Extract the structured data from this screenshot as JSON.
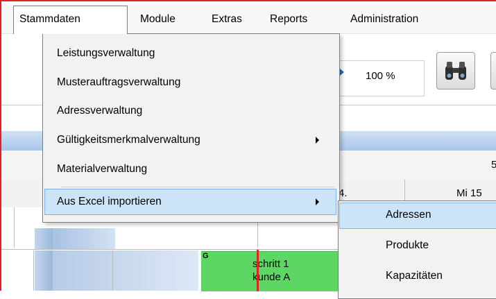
{
  "menubar": {
    "items": [
      "Stammdaten",
      "Module",
      "Extras",
      "Reports",
      "Administration"
    ],
    "active": "Stammdaten"
  },
  "toolbar": {
    "zoom_label": "100 %",
    "search_icon": "binoculars-icon"
  },
  "calendar": {
    "header_right_top": "5",
    "header_date_left": "4.",
    "header_date_right": "Mi 15",
    "task": {
      "line1": "schritt 1",
      "line2": "kunde A",
      "color": "#5dd663",
      "marker": "G"
    },
    "today_line_color": "#e02424"
  },
  "dropdown": {
    "items": [
      {
        "label": "Leistungsverwaltung",
        "submenu": false
      },
      {
        "label": "Musterauftragsverwaltung",
        "submenu": false
      },
      {
        "label": "Adressverwaltung",
        "submenu": false
      },
      {
        "label": "Gültigkeitsmerkmalverwaltung",
        "submenu": true
      },
      {
        "label": "Materialverwaltung",
        "submenu": false
      },
      {
        "label": "Aus Excel importieren",
        "submenu": true,
        "highlighted": true
      }
    ]
  },
  "submenu": {
    "items": [
      "Adressen",
      "Produkte",
      "Kapazitäten"
    ],
    "highlighted": "Adressen"
  },
  "colors": {
    "highlight_bg": "#cce4f7",
    "highlight_border": "#7eb4ea",
    "frame": "#d9222a"
  }
}
